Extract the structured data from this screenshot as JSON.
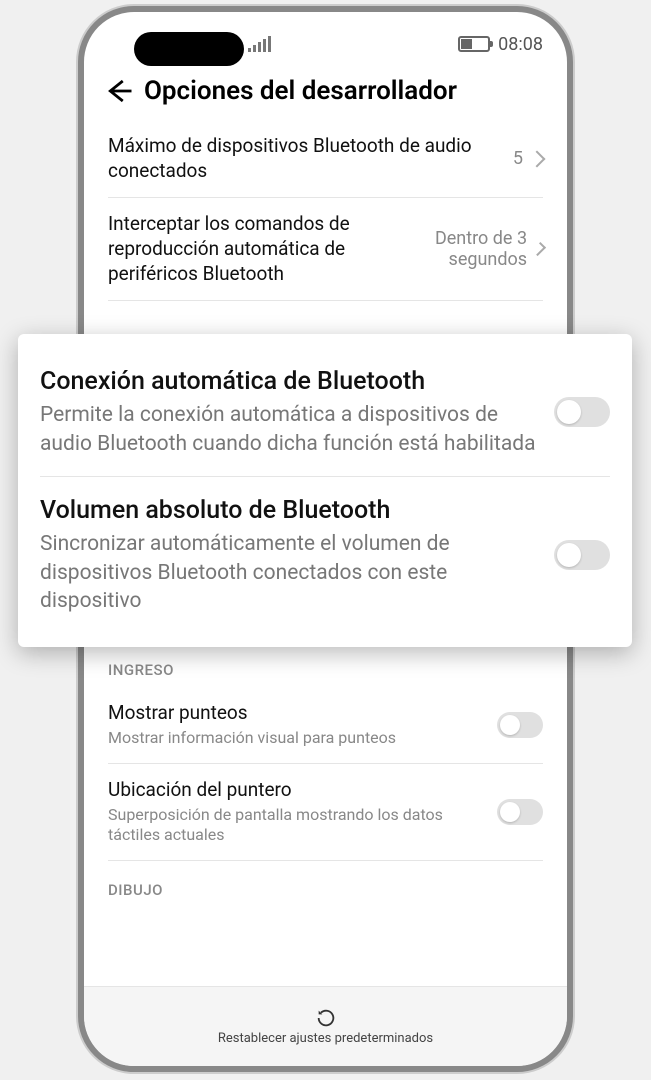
{
  "statusbar": {
    "time": "08:08"
  },
  "header": {
    "title": "Opciones del desarrollador"
  },
  "rows": {
    "maxAudio": {
      "title": "Máximo de dispositivos Bluetooth de audio conectados",
      "value": "5"
    },
    "intercept": {
      "title": "Interceptar los comandos de reproducción automática de periféricos Bluetooth",
      "value": "Dentro de 3 segundos"
    }
  },
  "overlay": {
    "auto": {
      "title": "Conexión automática de Bluetooth",
      "sub": "Permite la conexión automática a dispositivos de audio Bluetooth cuando dicha función está habilitada"
    },
    "absVol": {
      "title": "Volumen absoluto de Bluetooth",
      "sub": "Sincronizar automáticamente el volumen de dispositivos Bluetooth conectados con este dispositivo"
    }
  },
  "sections": {
    "input": "INGRESO",
    "drawing": "DIBUJO"
  },
  "inputRows": {
    "taps": {
      "title": "Mostrar punteos",
      "sub": "Mostrar información visual para punteos"
    },
    "pointer": {
      "title": "Ubicación del puntero",
      "sub": "Superposición de pantalla mostrando los datos táctiles actuales"
    }
  },
  "bottom": {
    "reset": "Restablecer ajustes predeterminados"
  }
}
